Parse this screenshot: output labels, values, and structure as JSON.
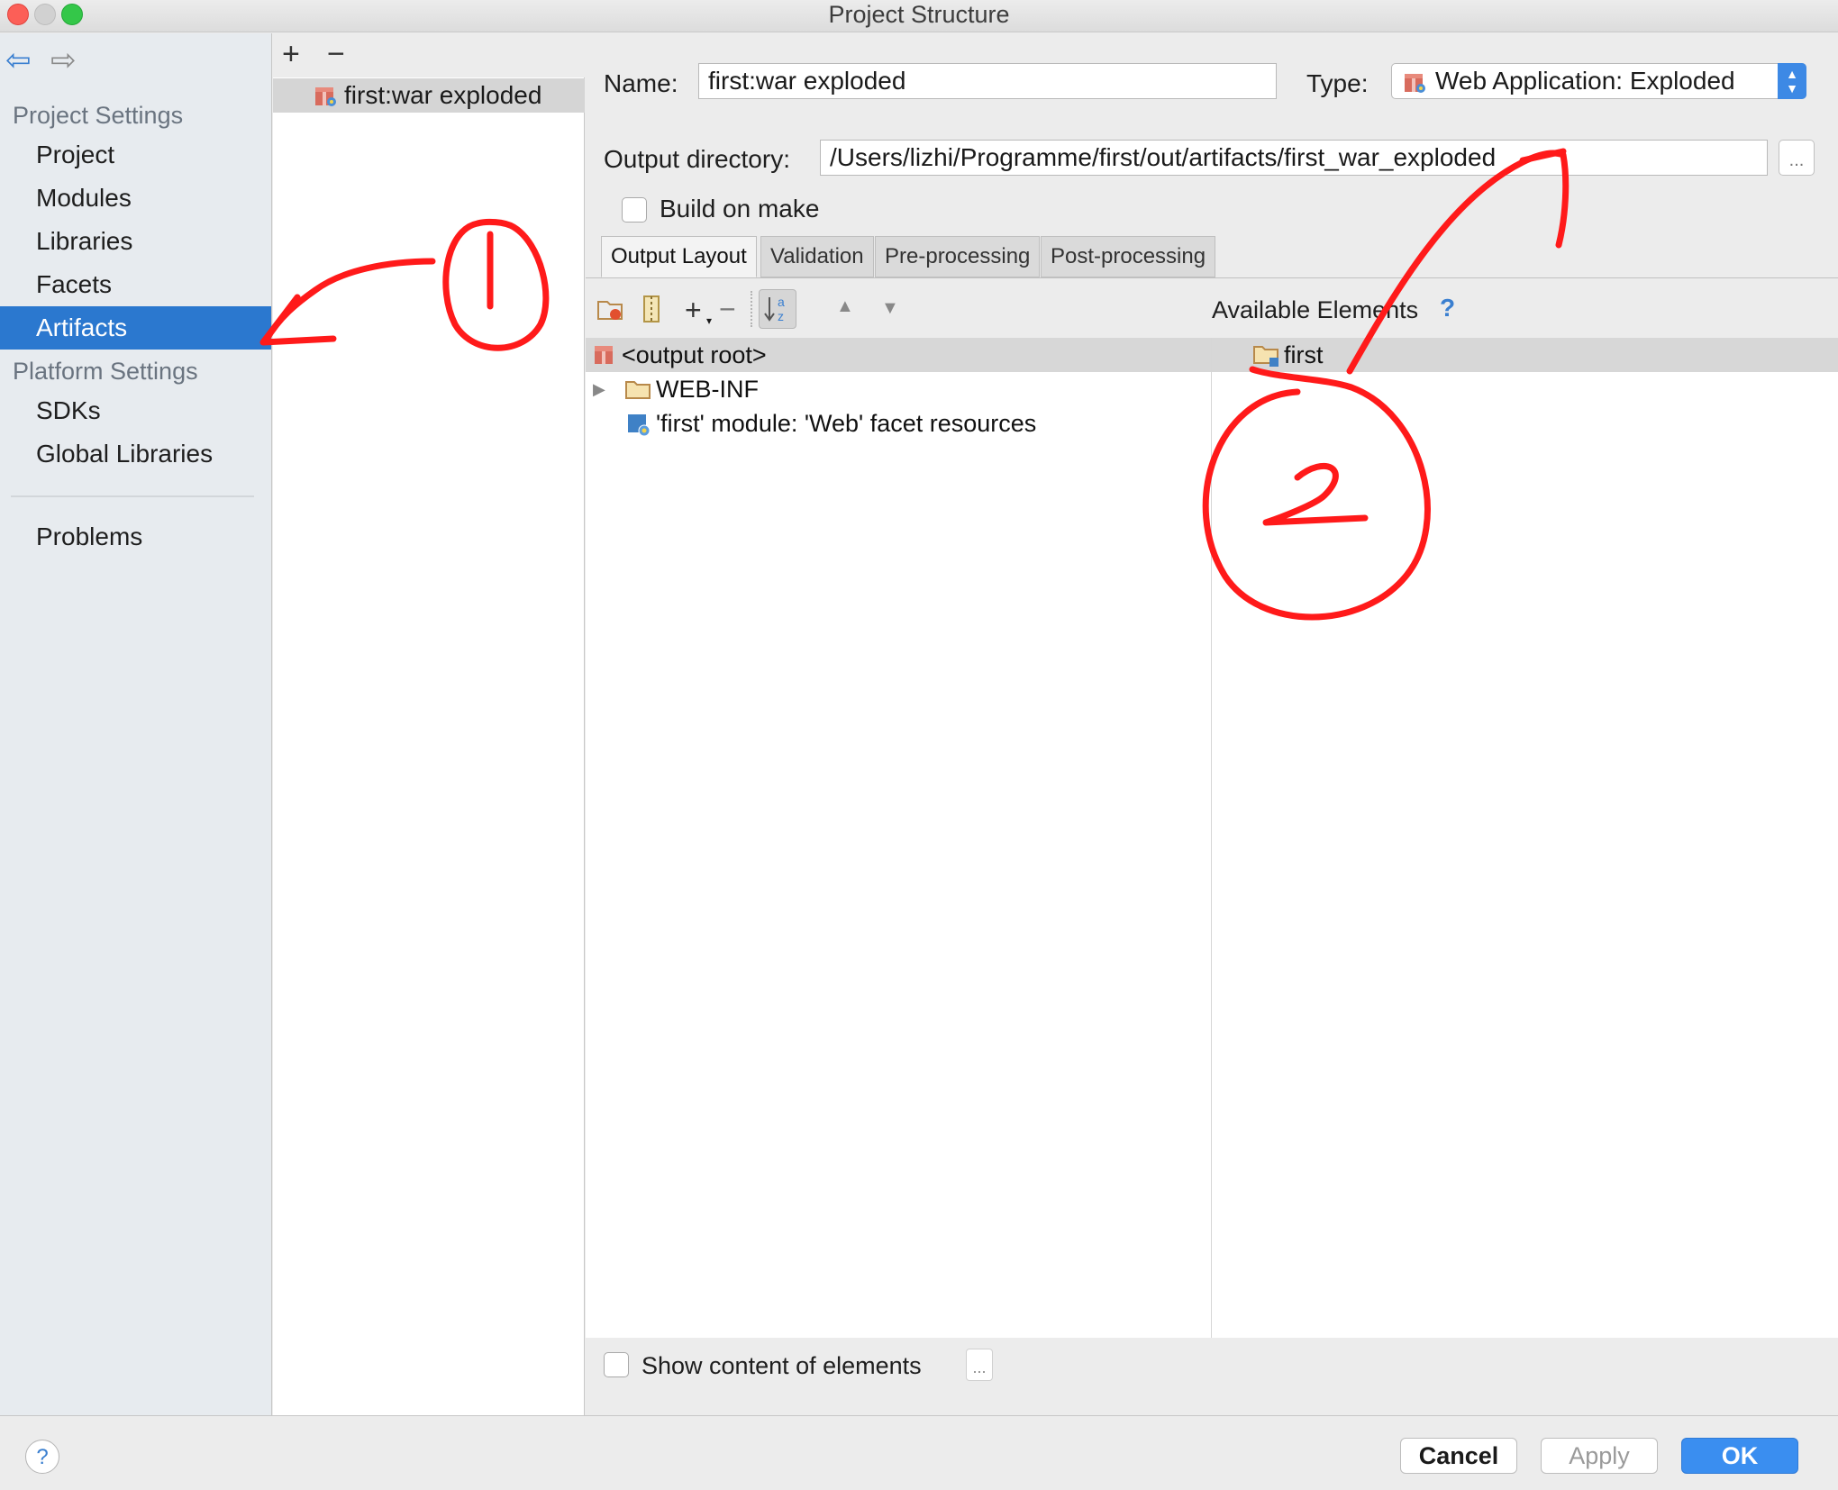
{
  "window": {
    "title": "Project Structure",
    "traffic_colors": {
      "close": "#fc5f57",
      "minimize": "#d1d1d1",
      "zoom": "#34c749"
    }
  },
  "sidebar": {
    "sections": [
      {
        "label": "Project Settings",
        "items": [
          "Project",
          "Modules",
          "Libraries",
          "Facets",
          "Artifacts"
        ]
      },
      {
        "label": "Platform Settings",
        "items": [
          "SDKs",
          "Global Libraries"
        ]
      }
    ],
    "problems": "Problems",
    "selected": "Artifacts",
    "accent": "#2b78cf"
  },
  "artifacts_list": {
    "add": "+",
    "remove": "−",
    "items": [
      "first:war exploded"
    ]
  },
  "editor": {
    "name_label": "Name:",
    "name_value": "first:war exploded",
    "type_label": "Type:",
    "type_value": "Web Application: Exploded",
    "output_label": "Output directory:",
    "output_value": "/Users/lizhi/Programme/first/out/artifacts/first_war_exploded",
    "browse": "...",
    "build_on_make": "Build on make",
    "build_on_make_checked": false,
    "tabs": [
      "Output Layout",
      "Validation",
      "Pre-processing",
      "Post-processing"
    ],
    "active_tab": "Output Layout"
  },
  "layout": {
    "tree": [
      {
        "label": "<output root>",
        "icon": "artifact-icon"
      },
      {
        "label": "WEB-INF",
        "icon": "folder-icon",
        "expandable": true
      },
      {
        "label": "'first' module: 'Web' facet resources",
        "icon": "web-facet-icon"
      }
    ],
    "available_label": "Available Elements",
    "help": "?",
    "available": [
      {
        "label": "first",
        "icon": "module-folder-icon"
      }
    ],
    "show_content": "Show content of elements",
    "show_content_browse": "..."
  },
  "footer": {
    "help": "?",
    "cancel": "Cancel",
    "apply": "Apply",
    "ok": "OK"
  },
  "annotations": {
    "color": "#ff1a1a"
  }
}
